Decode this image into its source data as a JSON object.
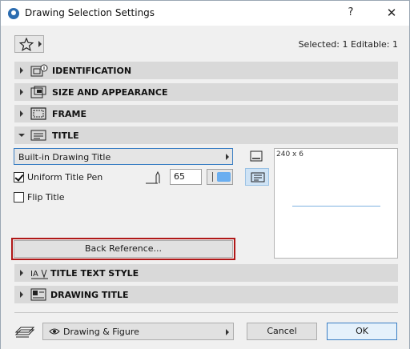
{
  "window": {
    "title": "Drawing Selection Settings",
    "help_label": "?",
    "close_label": "✕"
  },
  "header": {
    "selection_status": "Selected: 1 Editable: 1",
    "favorites_icon": "star-icon"
  },
  "sections": [
    {
      "label": "IDENTIFICATION",
      "icon": "identification-icon",
      "expanded": false
    },
    {
      "label": "SIZE AND APPEARANCE",
      "icon": "size-appearance-icon",
      "expanded": false
    },
    {
      "label": "FRAME",
      "icon": "frame-icon",
      "expanded": false
    },
    {
      "label": "TITLE",
      "icon": "title-icon",
      "expanded": true
    },
    {
      "label": "TITLE TEXT STYLE",
      "icon": "text-style-icon",
      "expanded": false
    },
    {
      "label": "DRAWING TITLE",
      "icon": "drawing-title-icon",
      "expanded": false
    }
  ],
  "title_panel": {
    "title_type": "Built-in Drawing Title",
    "uniform_title_pen": {
      "label": "Uniform Title Pen",
      "checked": true
    },
    "pen_number": "65",
    "pen_color": "#6aaef0",
    "flip_title": {
      "label": "Flip Title",
      "checked": false
    },
    "preview_size": "240 x 6",
    "back_reference_label": "Back Reference..."
  },
  "footer": {
    "layer_mode": "Drawing & Figure",
    "cancel_label": "Cancel",
    "ok_label": "OK"
  },
  "colors": {
    "accent": "#3b7fc4",
    "highlight_border": "#b01818",
    "section_bg": "#d9d9d9"
  }
}
